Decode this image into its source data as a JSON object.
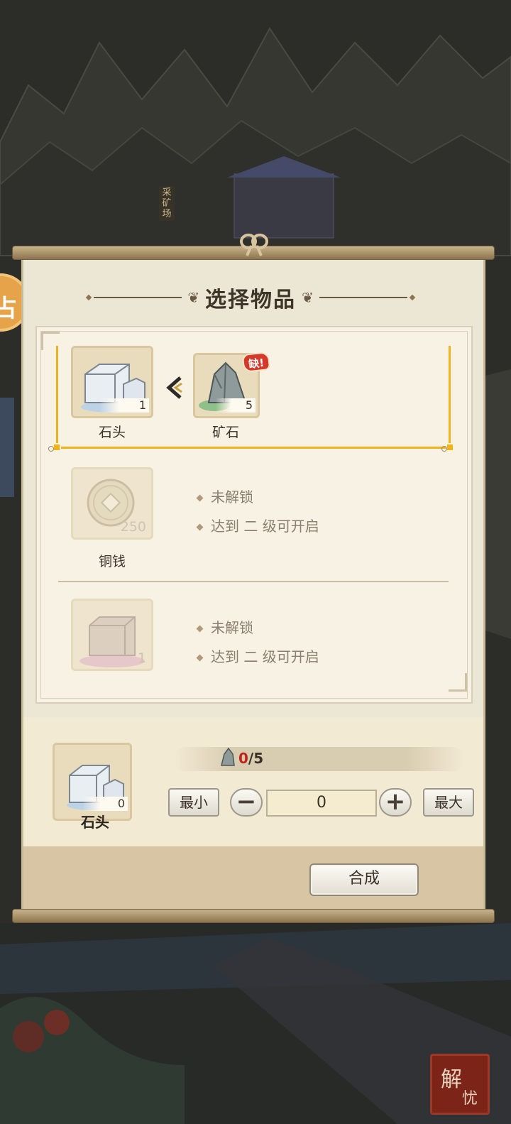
{
  "background": {
    "location_label": "采矿场",
    "corner_badge_text": [
      "解",
      "忧"
    ],
    "left_orb_glyph": "占"
  },
  "dialog": {
    "title": "选择物品"
  },
  "recipes": {
    "selected": {
      "output": {
        "name": "石头",
        "count": "1",
        "icon": "stone-block-icon"
      },
      "input": {
        "name": "矿石",
        "count": "5",
        "icon": "ore-rock-icon",
        "badge": "缺!"
      }
    },
    "locked": [
      {
        "name": "铜钱",
        "count": "250",
        "icon": "copper-coin-icon",
        "status": "未解锁",
        "requirement": "达到 二 级可开启"
      },
      {
        "name": "",
        "count": "1",
        "icon": "brick-block-icon",
        "status": "未解锁",
        "requirement": "达到 二 级可开启"
      }
    ]
  },
  "craft": {
    "selected_item": {
      "name": "石头",
      "count": "0",
      "icon": "stone-block-icon"
    },
    "material_progress": {
      "current": "0",
      "required": "/5"
    },
    "buttons": {
      "min_label": "最小",
      "minus_label": "−",
      "plus_label": "+",
      "max_label": "最大",
      "synthesize_label": "合成"
    },
    "quantity": "0"
  },
  "colors": {
    "selection_gold": "#f0b21f",
    "lack_red": "#d43a2a",
    "panel_paper": "#ece6d4"
  }
}
